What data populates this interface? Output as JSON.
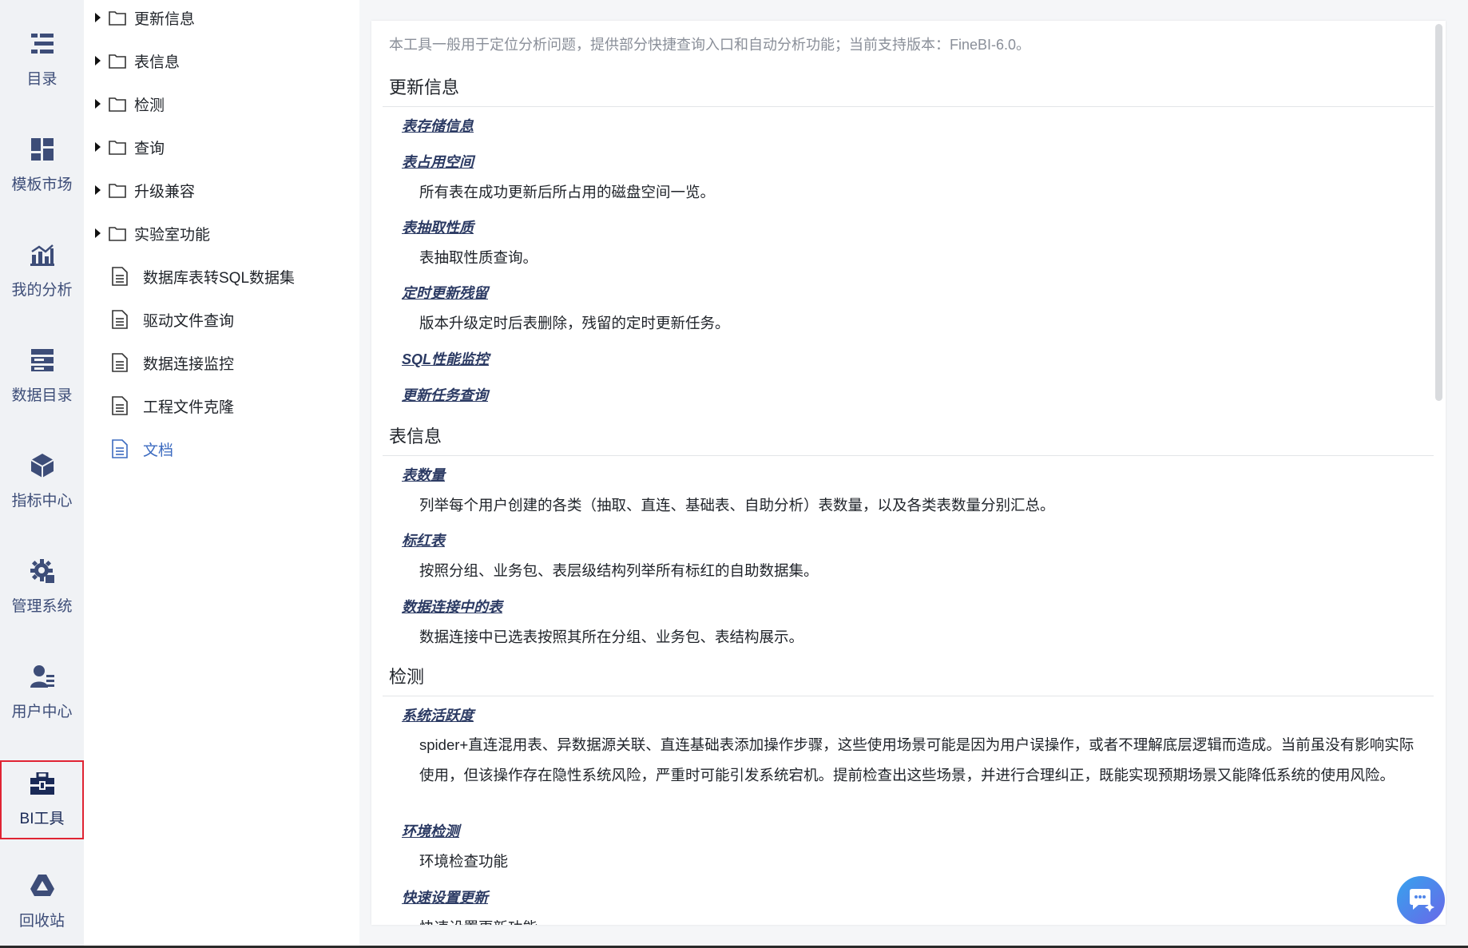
{
  "nav": {
    "items": [
      {
        "label": "目录",
        "icon": "catalog-icon"
      },
      {
        "label": "模板市场",
        "icon": "template-market-icon"
      },
      {
        "label": "我的分析",
        "icon": "my-analysis-icon"
      },
      {
        "label": "数据目录",
        "icon": "data-catalog-icon"
      },
      {
        "label": "指标中心",
        "icon": "metrics-center-icon"
      },
      {
        "label": "管理系统",
        "icon": "management-gear-icon"
      },
      {
        "label": "用户中心",
        "icon": "user-center-icon"
      },
      {
        "label": "BI工具",
        "icon": "bi-tools-toolbox-icon"
      },
      {
        "label": "回收站",
        "icon": "recycle-bin-icon"
      }
    ],
    "active_index": 7,
    "icon_color": "#3d4d78",
    "active_border_color": "#e02433"
  },
  "tree": {
    "folders": [
      "更新信息",
      "表信息",
      "检测",
      "查询",
      "升级兼容",
      "实验室功能"
    ],
    "files": [
      "数据库表转SQL数据集",
      "驱动文件查询",
      "数据连接监控",
      "工程文件克隆",
      "文档"
    ],
    "selected_file_index": 4,
    "selected_color": "#3c6bc0"
  },
  "content": {
    "intro": "本工具一般用于定位分析问题，提供部分快捷查询入口和自动分析功能；当前支持版本：FineBI-6.0。",
    "sections": [
      {
        "title": "更新信息",
        "items": [
          {
            "title": "表存储信息",
            "desc": ""
          },
          {
            "title": "表占用空间",
            "desc": "所有表在成功更新后所占用的磁盘空间一览。"
          },
          {
            "title": "表抽取性质",
            "desc": "表抽取性质查询。"
          },
          {
            "title": "定时更新残留",
            "desc": "版本升级定时后表删除，残留的定时更新任务。"
          },
          {
            "title": "SQL性能监控",
            "desc": ""
          },
          {
            "title": "更新任务查询",
            "desc": ""
          }
        ]
      },
      {
        "title": "表信息",
        "items": [
          {
            "title": "表数量",
            "desc": "列举每个用户创建的各类（抽取、直连、基础表、自助分析）表数量，以及各类表数量分别汇总。"
          },
          {
            "title": "标红表",
            "desc": "按照分组、业务包、表层级结构列举所有标红的自助数据集。"
          },
          {
            "title": "数据连接中的表",
            "desc": "数据连接中已选表按照其所在分组、业务包、表结构展示。"
          }
        ]
      },
      {
        "title": "检测",
        "items": [
          {
            "title": "系统活跃度",
            "desc": "spider+直连混用表、异数据源关联、直连基础表添加操作步骤，这些使用场景可能是因为用户误操作，或者不理解底层逻辑而造成。当前虽没有影响实际使用，但该操作存在隐性系统风险，严重时可能引发系统宕机。提前检查出这些场景，并进行合理纠正，既能实现预期场景又能降低系统的使用风险。"
          },
          {
            "title": "环境检测",
            "desc": "环境检查功能"
          },
          {
            "title": "快速设置更新",
            "desc": "快速设置更新功能"
          }
        ]
      }
    ]
  },
  "chat_button": {
    "icon": "chat-assistant-icon",
    "gradient": [
      "#36a3ee",
      "#6a67e8"
    ]
  }
}
